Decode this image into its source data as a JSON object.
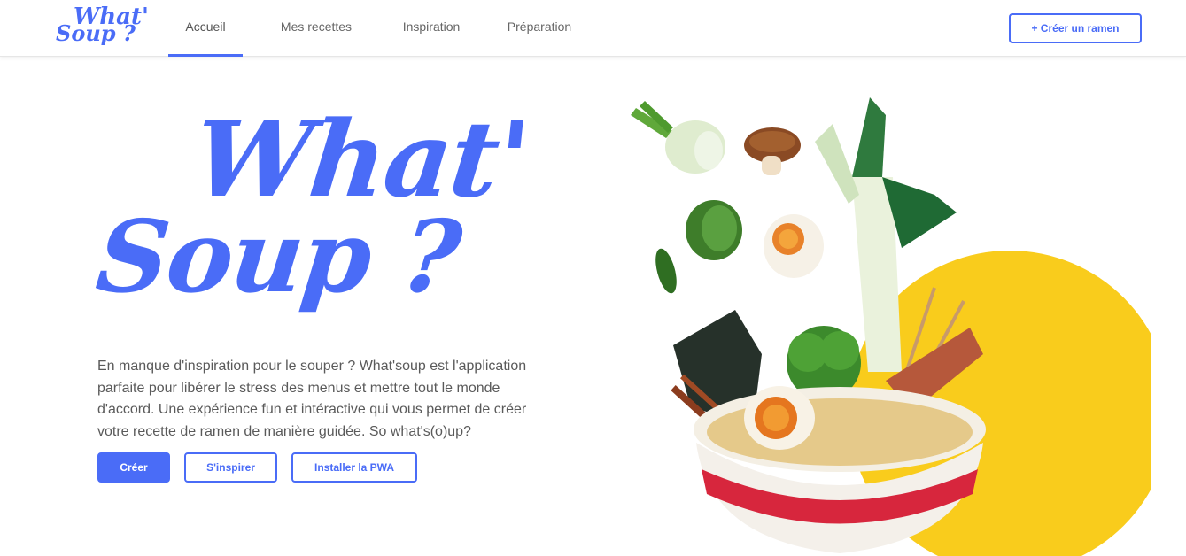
{
  "brand": {
    "logo_line1": "What'",
    "logo_line2": "Soup ?"
  },
  "nav": {
    "items": [
      {
        "label": "Accueil",
        "active": true
      },
      {
        "label": "Mes recettes",
        "active": false
      },
      {
        "label": "Inspiration",
        "active": false
      },
      {
        "label": "Préparation",
        "active": false
      }
    ],
    "create_button": "+ Créer un ramen"
  },
  "hero": {
    "title_line1": "What'",
    "title_line2": "Soup ?",
    "description": "En manque d'inspiration pour le souper ? What'soup est l'application parfaite pour libérer le stress des menus et mettre tout le monde d'accord. Une expérience fun et intéractive qui vous permet de créer votre recette de ramen de manière guidée. So what's(o)up?",
    "buttons": {
      "create": "Créer",
      "inspire": "S'inspirer",
      "install": "Installer la PWA"
    }
  },
  "colors": {
    "accent": "#4a6cf7",
    "sun": "#f9cc1c",
    "bowl_red": "#d7263d"
  },
  "illustration": {
    "icon": "ramen-bowl-illustration"
  }
}
